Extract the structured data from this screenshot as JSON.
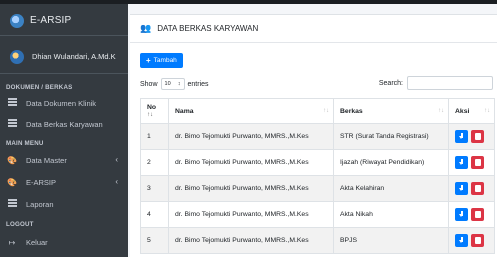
{
  "app": {
    "title": "E-ARSIP"
  },
  "user": {
    "name": "Dhian Wulandari, A.Md.K"
  },
  "sidebar": {
    "sections": [
      {
        "header": "DOKUMEN / BERKAS"
      },
      {
        "header": "MAIN MENU"
      },
      {
        "header": "LOGOUT"
      }
    ],
    "items": [
      {
        "label": "Data Dokumen Klinik",
        "icon": "table-icon"
      },
      {
        "label": "Data Berkas Karyawan",
        "icon": "table-icon"
      },
      {
        "label": "Data Master",
        "icon": "palette-icon"
      },
      {
        "label": "E-ARSIP",
        "icon": "palette-icon"
      },
      {
        "label": "Laporan",
        "icon": "table-icon"
      },
      {
        "label": "Keluar",
        "icon": "logout-icon"
      }
    ]
  },
  "card": {
    "title": "DATA BERKAS KARYAWAN",
    "add_button": "Tambah",
    "show_label": "Show",
    "entries_value": "10",
    "entries_label": "entries",
    "search_label": "Search:"
  },
  "table": {
    "headers": [
      "No",
      "Nama",
      "Berkas",
      "Aksi"
    ],
    "rows": [
      {
        "no": "1",
        "nama": "dr. Bimo Tejomukti Purwanto, MMRS.,M.Kes",
        "berkas": "STR (Surat Tanda Registrasi)"
      },
      {
        "no": "2",
        "nama": "dr. Bimo Tejomukti Purwanto, MMRS.,M.Kes",
        "berkas": "Ijazah (Riwayat Pendidikan)"
      },
      {
        "no": "3",
        "nama": "dr. Bimo Tejomukti Purwanto, MMRS.,M.Kes",
        "berkas": "Akta Kelahiran"
      },
      {
        "no": "4",
        "nama": "dr. Bimo Tejomukti Purwanto, MMRS.,M.Kes",
        "berkas": "Akta Nikah"
      },
      {
        "no": "5",
        "nama": "dr. Bimo Tejomukti Purwanto, MMRS.,M.Kes",
        "berkas": "BPJS"
      }
    ]
  },
  "colors": {
    "sidebar": "#343a40",
    "primary": "#007bff",
    "danger": "#dc3545"
  }
}
